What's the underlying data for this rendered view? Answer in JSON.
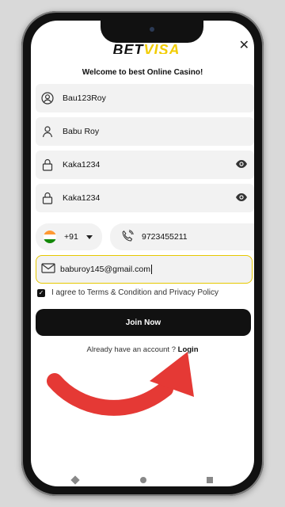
{
  "logo": {
    "part1": "BET",
    "part2": "VISA"
  },
  "close_glyph": "✕",
  "welcome": "Welcome to best Online Casino!",
  "fields": {
    "username": "Bau123Roy",
    "fullname": "Babu  Roy",
    "password": "Kaka1234",
    "confirm_password": "Kaka1234"
  },
  "phone": {
    "country_code": "+91",
    "number": "9723455211"
  },
  "email": "baburoy145@gmail.com",
  "agree_text": "I agree to Terms & Condition and Privacy Policy",
  "join_label": "Join Now",
  "login_prompt": "Already have an account ?",
  "login_label": "Login",
  "colors": {
    "accent": "#f2cc00",
    "arrow": "#e53935",
    "button": "#111111"
  },
  "icons": [
    "user-icon",
    "lock-icon",
    "eye-icon",
    "phone-icon",
    "mail-icon",
    "india-flag-icon"
  ]
}
